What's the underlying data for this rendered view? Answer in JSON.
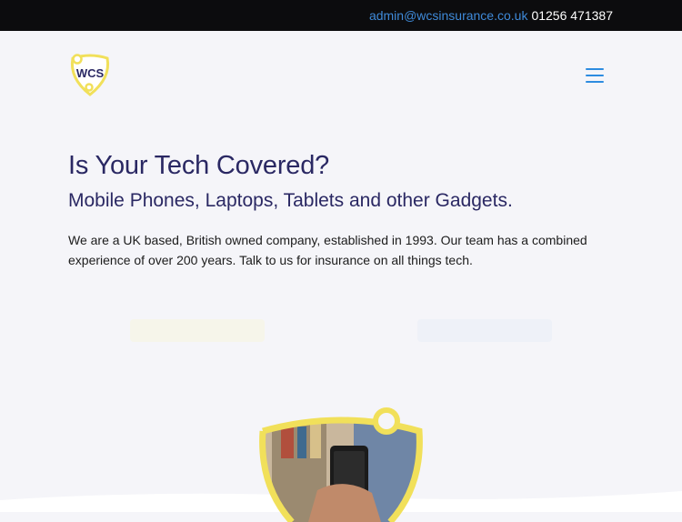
{
  "topbar": {
    "email": "admin@wcsinsurance.co.uk",
    "phone": "01256 471387"
  },
  "logo": {
    "text": "WCS"
  },
  "hero": {
    "title": "Is Your Tech Covered?",
    "subtitle": "Mobile Phones, Laptops, Tablets and other Gadgets.",
    "body": "We are a UK based, British owned company, established in 1993. Our team has a combined experience of over 200 years. Talk to us for insurance on all things tech."
  },
  "colors": {
    "brand_navy": "#2a2863",
    "brand_yellow": "#f1e05a",
    "link_blue": "#3f8ad9",
    "topbar_bg": "#0c0c0e",
    "page_bg": "#f5f5f9"
  }
}
